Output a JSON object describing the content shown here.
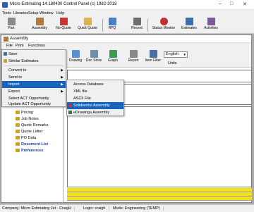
{
  "app": {
    "title": "Micro Estimating 14.180430 Control Panel (c) 1982-2018"
  },
  "menubar": [
    "Tools",
    "Libraries",
    "Setup",
    "Window",
    "Help"
  ],
  "toolbar": [
    "Part",
    "Assembly",
    "No-Quote",
    "Quick Quote",
    "RFQ",
    "Recent",
    "Status Monitor",
    "Estimates",
    "Activities"
  ],
  "assembly": {
    "title": "Assembly",
    "menu": [
      "File",
      "Print",
      "Functions"
    ],
    "toolbar": [
      "Drawing",
      "Doc Store",
      "Graph",
      "Report",
      "Item Filter",
      "Units"
    ],
    "language": "English"
  },
  "file_menu": {
    "items": [
      "Save",
      "Similar Estimates",
      "Convert to",
      "Send to",
      "Import",
      "Export",
      "Select ACT Opportunity",
      "Update ACT Opportunity"
    ]
  },
  "import_menu": {
    "items": [
      "Access Database",
      "XML file",
      "ASCII File",
      "Solidworks Assembly",
      "eDrawings Assembly"
    ],
    "highlighted": "Solidworks Assembly"
  },
  "tree": {
    "items": [
      "Pricing",
      "Job Notes",
      "Quote Remarks",
      "Quote Letter",
      "PO Data",
      "Document List",
      "Preferences"
    ]
  },
  "status": {
    "company": "Company: Micro Estimating Jet - CraigH",
    "login": "Login: craigh",
    "mode": "Mode: Engineering (TEMP)"
  }
}
